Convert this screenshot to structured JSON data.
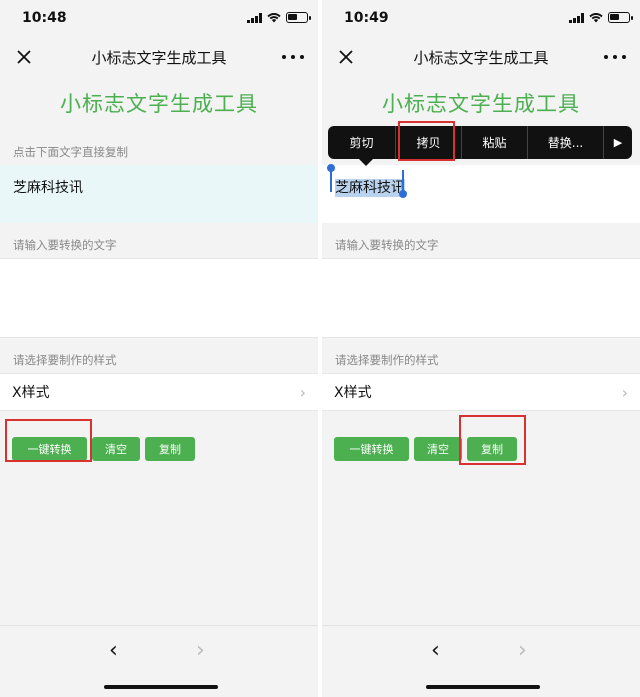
{
  "left": {
    "status_time": "10:48",
    "nav_title": "小标志文字生成工具",
    "hero_title": "小标志文字生成工具",
    "copy_label": "点击下面文字直接复制",
    "copy_text": "芝麻科技讯",
    "input_label": "请输入要转换的文字",
    "style_label": "请选择要制作的样式",
    "style_value": "X样式",
    "btn_convert": "一键转换",
    "btn_clear": "清空",
    "btn_copy": "复制"
  },
  "right": {
    "status_time": "10:49",
    "nav_title": "小标志文字生成工具",
    "hero_title": "小标志文字生成工具",
    "copy_text": "芝麻科技讯",
    "input_label": "请输入要转换的文字",
    "style_label": "请选择要制作的样式",
    "style_value": "X样式",
    "btn_convert": "一键转换",
    "btn_clear": "清空",
    "btn_copy": "复制",
    "context_menu": [
      "剪切",
      "拷贝",
      "粘贴",
      "替换...",
      "▶"
    ]
  },
  "icons": {
    "close": "close-icon",
    "more": "more-dots-icon",
    "chevron": "chevron-right-icon",
    "back": "back-arrow-icon",
    "forward": "forward-arrow-icon"
  },
  "colors": {
    "accent_green": "#4caf50",
    "highlight_red": "#d93030",
    "copy_bg": "#e9f7f8",
    "selection_blue": "#2d6fd6"
  }
}
